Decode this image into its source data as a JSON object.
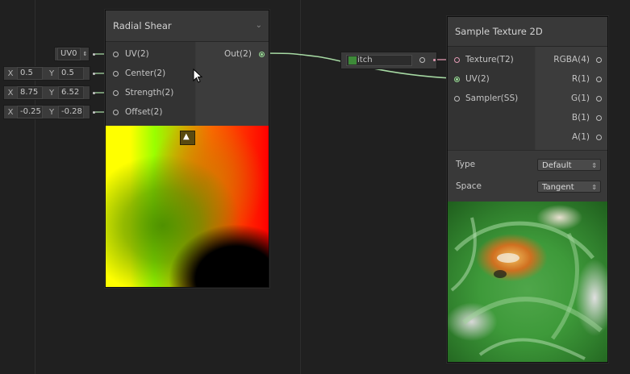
{
  "canvas": {
    "background": "#202020",
    "edge_color": "#a6d9a3"
  },
  "radial_shear": {
    "title": "Radial Shear",
    "inputs": [
      "UV(2)",
      "Center(2)",
      "Strength(2)",
      "Offset(2)"
    ],
    "output": "Out(2)"
  },
  "inline_inputs": {
    "uv_channel": "UV0",
    "center": {
      "x_label": "X",
      "x": "0.5",
      "y_label": "Y",
      "y": "0.5"
    },
    "strength": {
      "x_label": "X",
      "x": "8.75",
      "y_label": "Y",
      "y": "6.52"
    },
    "offset": {
      "x_label": "X",
      "x": "-0.25",
      "y_label": "Y",
      "y": "-0.28"
    }
  },
  "floating_node": {
    "label": "itch"
  },
  "sample_texture": {
    "title": "Sample Texture 2D",
    "inputs": [
      "Texture(T2)",
      "UV(2)",
      "Sampler(SS)"
    ],
    "outputs": [
      "RGBA(4)",
      "R(1)",
      "G(1)",
      "B(1)",
      "A(1)"
    ],
    "type_label": "Type",
    "type_value": "Default",
    "space_label": "Space",
    "space_value": "Tangent"
  }
}
